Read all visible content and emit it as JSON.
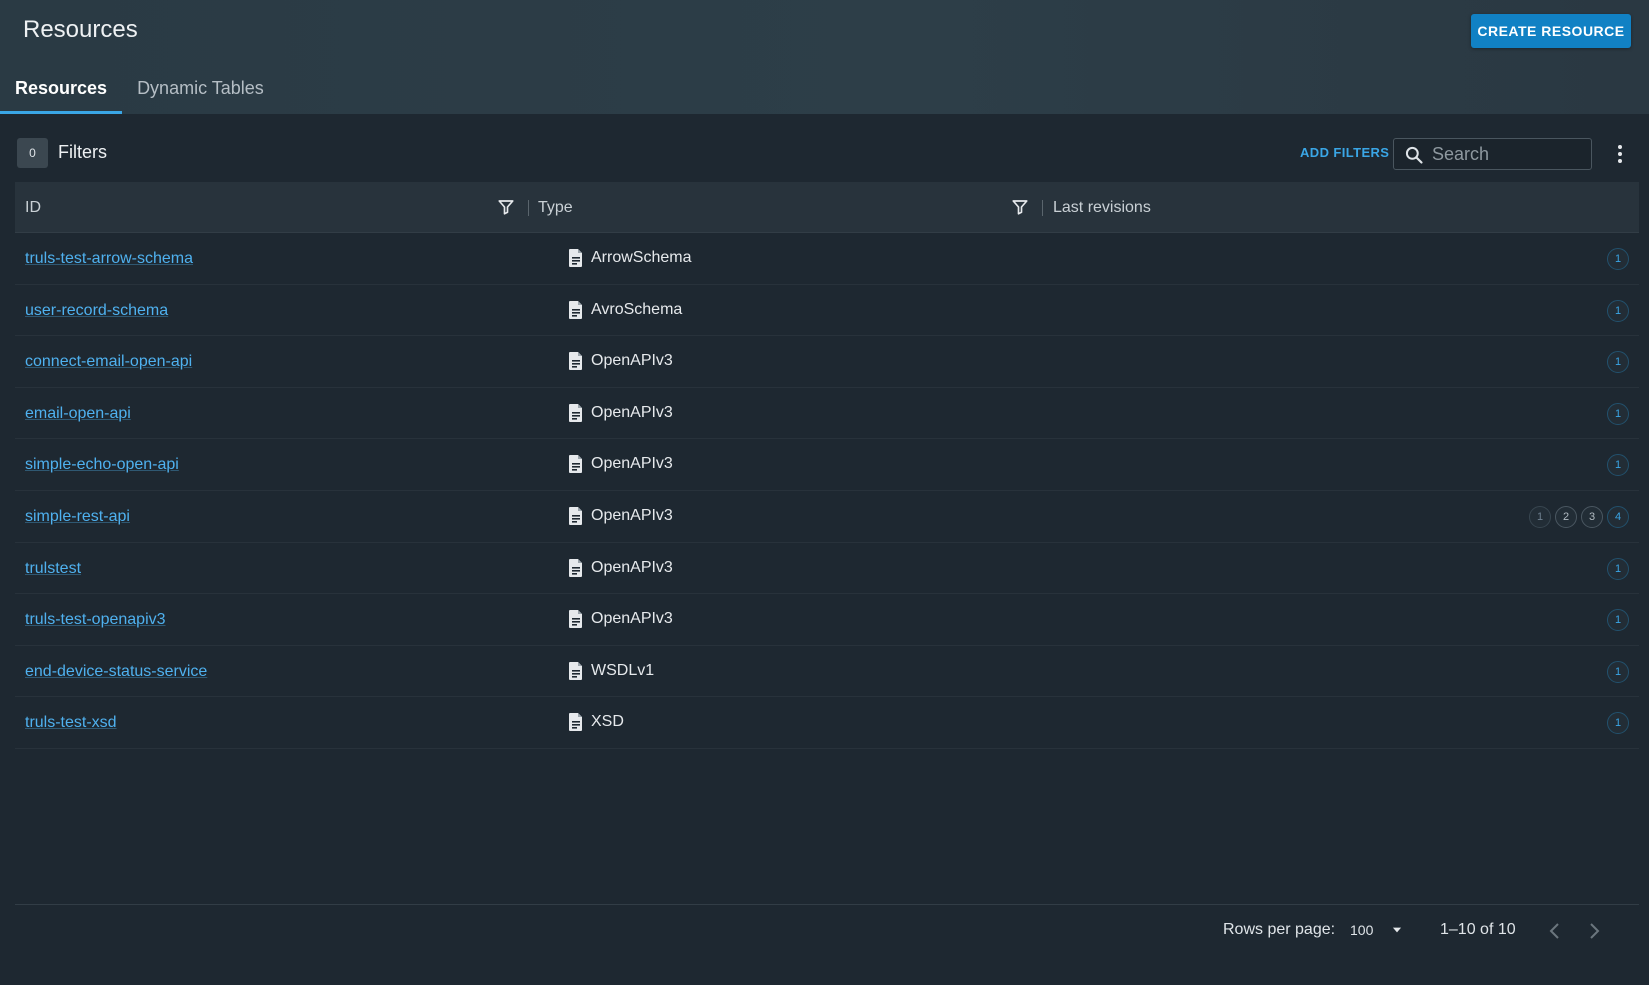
{
  "header": {
    "title": "Resources",
    "create_button": "CREATE RESOURCE",
    "tabs": [
      {
        "label": "Resources",
        "active": true
      },
      {
        "label": "Dynamic Tables",
        "active": false
      }
    ]
  },
  "filters": {
    "count": "0",
    "label": "Filters",
    "add_filters": "ADD FILTERS",
    "search_placeholder": "Search"
  },
  "table": {
    "columns": {
      "id": "ID",
      "type": "Type",
      "last_revisions": "Last revisions"
    },
    "rows": [
      {
        "id": "truls-test-arrow-schema",
        "type": "ArrowSchema",
        "revisions": [
          "1"
        ]
      },
      {
        "id": "user-record-schema",
        "type": "AvroSchema",
        "revisions": [
          "1"
        ]
      },
      {
        "id": "connect-email-open-api",
        "type": "OpenAPIv3",
        "revisions": [
          "1"
        ]
      },
      {
        "id": "email-open-api",
        "type": "OpenAPIv3",
        "revisions": [
          "1"
        ]
      },
      {
        "id": "simple-echo-open-api",
        "type": "OpenAPIv3",
        "revisions": [
          "1"
        ]
      },
      {
        "id": "simple-rest-api",
        "type": "OpenAPIv3",
        "revisions": [
          "1",
          "2",
          "3",
          "4"
        ]
      },
      {
        "id": "trulstest",
        "type": "OpenAPIv3",
        "revisions": [
          "1"
        ]
      },
      {
        "id": "truls-test-openapiv3",
        "type": "OpenAPIv3",
        "revisions": [
          "1"
        ]
      },
      {
        "id": "end-device-status-service",
        "type": "WSDLv1",
        "revisions": [
          "1"
        ]
      },
      {
        "id": "truls-test-xsd",
        "type": "XSD",
        "revisions": [
          "1"
        ]
      }
    ]
  },
  "pagination": {
    "rows_per_page_label": "Rows per page:",
    "rows_per_page_value": "100",
    "range": "1–10 of 10"
  },
  "colors": {
    "background": "#1e2831",
    "header": "#2d3e48",
    "accent": "#1181c4",
    "link": "#4fb1ef"
  },
  "icons": {
    "search": "search-icon",
    "filter": "filter-icon",
    "document": "document-icon",
    "more": "more-vertical-icon",
    "caret": "caret-down-icon",
    "prev": "chevron-left-icon",
    "next": "chevron-right-icon"
  }
}
